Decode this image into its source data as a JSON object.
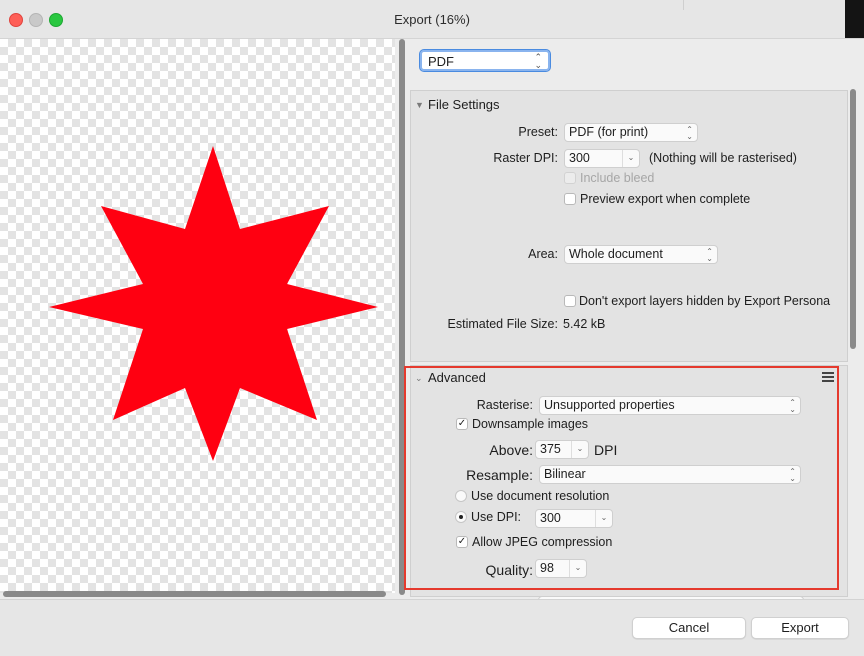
{
  "window": {
    "title": "Export (16%)"
  },
  "format": {
    "selected": "PDF"
  },
  "file_settings": {
    "title": "File Settings",
    "preset_label": "Preset:",
    "preset_value": "PDF (for print)",
    "raster_dpi_label": "Raster DPI:",
    "raster_dpi_value": "300",
    "raster_note": "(Nothing will be rasterised)",
    "include_bleed_label": "Include bleed",
    "include_bleed_checked": false,
    "preview_label": "Preview export when complete",
    "preview_checked": false,
    "area_label": "Area:",
    "area_value": "Whole document",
    "hidden_layers_label": "Don't export layers hidden by Export Persona",
    "hidden_layers_checked": false,
    "estimated_label": "Estimated File Size:",
    "estimated_value": "5.42 kB"
  },
  "advanced": {
    "title": "Advanced",
    "rasterise_label": "Rasterise:",
    "rasterise_value": "Unsupported properties",
    "downsample_label": "Downsample images",
    "downsample_checked": true,
    "above_label": "Above:",
    "above_value": "375",
    "above_unit": "DPI",
    "resample_label": "Resample:",
    "resample_value": "Bilinear",
    "use_doc_res_label": "Use document resolution",
    "use_dpi_label": "Use DPI:",
    "use_dpi_value": "300",
    "jpeg_label": "Allow JPEG compression",
    "jpeg_checked": true,
    "quality_label": "Quality:",
    "quality_value": "98"
  },
  "buttons": {
    "cancel": "Cancel",
    "export": "Export"
  },
  "colors": {
    "star": "#ff0011",
    "highlight": "#e53a2e",
    "focus": "#4a8be0"
  },
  "icons": {
    "checkmark": "✓",
    "menu": "hamburger-icon",
    "chevron": "up-down-chevron-icon"
  }
}
